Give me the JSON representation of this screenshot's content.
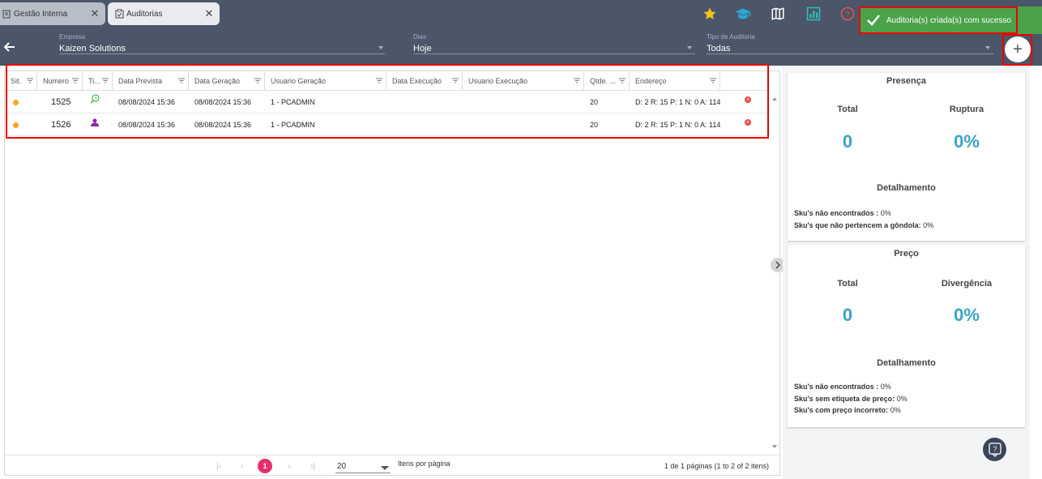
{
  "tabs": [
    {
      "label": "Gestão Interna",
      "icon": "document-scale-icon"
    },
    {
      "label": "Auditorias",
      "icon": "clipboard-check-icon"
    }
  ],
  "top_icons": [
    "star-icon",
    "graduation-cap-icon",
    "map-icon",
    "chart-icon",
    "help-circle-icon"
  ],
  "toast": {
    "message": "Auditoria(s) criada(s) com sucesso"
  },
  "filters": {
    "empresa": {
      "label": "Empresa",
      "value": "Kaizen Solutions"
    },
    "dias": {
      "label": "Dias",
      "value": "Hoje"
    },
    "tipo": {
      "label": "Tipo de Auditoria",
      "value": "Todas"
    }
  },
  "add_button": {
    "symbol": "+"
  },
  "grid": {
    "columns": [
      "Sit.",
      "Numero",
      "Ti...",
      "Data Prevista",
      "Data Geração",
      "Usuario Geração",
      "Data Execução",
      "Usuario Execução",
      "Qtde. ...",
      "Endereço"
    ],
    "rows": [
      {
        "numero": "1525",
        "tipo_icon": "search-clock-icon",
        "data_prevista": "08/08/2024 15:36",
        "data_geracao": "08/08/2024 15:36",
        "usuario_geracao": "1 - PCADMIN",
        "data_execucao": "",
        "usuario_execucao": "",
        "qtde": "20",
        "endereco": "D: 2 R: 15 P: 1 N: 0 A: 114"
      },
      {
        "numero": "1526",
        "tipo_icon": "user-icon",
        "data_prevista": "08/08/2024 15:36",
        "data_geracao": "08/08/2024 15:36",
        "usuario_geracao": "1 - PCADMIN",
        "data_execucao": "",
        "usuario_execucao": "",
        "qtde": "20",
        "endereco": "D: 2 R: 15 P: 1 N: 0 A: 114"
      }
    ]
  },
  "pager": {
    "current": "1",
    "page_size": "20",
    "page_size_label": "Itens por página",
    "info": "1 de 1 páginas (1 to 2 of 2 itens)"
  },
  "presenca": {
    "title": "Presença",
    "total_label": "Total",
    "total_value": "0",
    "ruptura_label": "Ruptura",
    "ruptura_value": "0%",
    "det_title": "Detalhamento",
    "det1_label": "Sku's não encontrados :",
    "det1_value": "0%",
    "det2_label": "Sku's que não pertencem a gôndola:",
    "det2_value": "0%"
  },
  "preco": {
    "title": "Preço",
    "total_label": "Total",
    "total_value": "0",
    "div_label": "Divergência",
    "div_value": "0%",
    "det_title": "Detalhamento",
    "det1_label": "Sku's não encontrados :",
    "det1_value": "0%",
    "det2_label": "Sku's sem etiqueta de preço:",
    "det2_value": "0%",
    "det3_label": "Sku's com preço incorreto:",
    "det3_value": "0%"
  },
  "colors": {
    "accent": "#3ba3c6",
    "toast": "#4aa34a",
    "pager_current": "#e5306f",
    "status_dot": "#f5a623",
    "highlight": "#e00000"
  }
}
